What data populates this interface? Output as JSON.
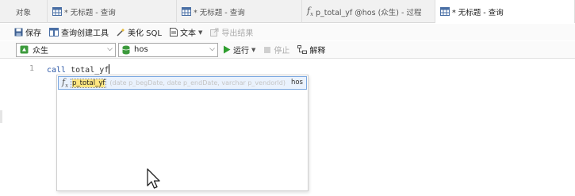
{
  "tabs": [
    {
      "label": "对象",
      "icon": "",
      "active": false
    },
    {
      "label": "* 无标题 - 查询",
      "icon": "query-table-icon",
      "active": false
    },
    {
      "label": "* 无标题 - 查询",
      "icon": "query-table-icon",
      "active": false
    },
    {
      "label": "p_total_yf @hos (众生) - 过程",
      "icon": "function-fx-icon",
      "active": false
    },
    {
      "label": "* 无标题 - 查询",
      "icon": "query-table-icon",
      "active": true
    }
  ],
  "toolbar": {
    "save": "保存",
    "query_builder": "查询创建工具",
    "beautify_sql": "美化 SQL",
    "text": "文本",
    "export_result": "导出结果"
  },
  "selectors": {
    "connection": "众生",
    "database": "hos",
    "run": "运行",
    "stop": "停止",
    "explain": "解释"
  },
  "editor": {
    "line_number": "1",
    "keyword": "call",
    "identifier": "total_yf"
  },
  "autocomplete": {
    "name_highlight": "p_total_yf",
    "args": "(date p_begDate, date p_endDate, varchar p_vendorId)",
    "database": "hos"
  },
  "colors": {
    "accent_blue": "#2a56a5",
    "run_green": "#2e9e2e",
    "connection_green": "#3c9a3c",
    "suggest_border": "#7aa7e0"
  }
}
